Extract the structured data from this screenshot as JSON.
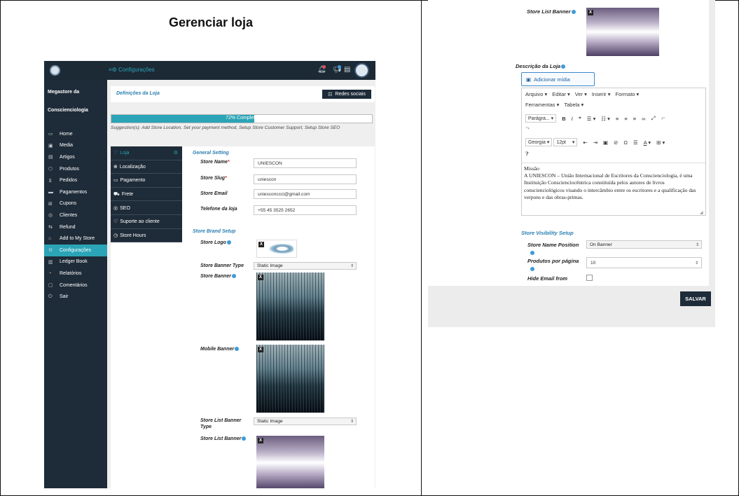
{
  "caption": "Gerenciar loja",
  "left": {
    "topbar": {
      "config_label": "Configurações"
    },
    "sidebar": {
      "store_name_1": "Megastore da",
      "store_name_2": "Conscienciologia",
      "items": [
        {
          "label": "Home",
          "icon": "monitor-icon",
          "glyph": "▭"
        },
        {
          "label": "Media",
          "icon": "image-icon",
          "glyph": "▣"
        },
        {
          "label": "Artigos",
          "icon": "document-icon",
          "glyph": "▤"
        },
        {
          "label": "Produtos",
          "icon": "cube-icon",
          "glyph": "⬡"
        },
        {
          "label": "Pedidos",
          "icon": "cart-icon",
          "glyph": "⊻"
        },
        {
          "label": "Pagamentos",
          "icon": "card-icon",
          "glyph": "▬"
        },
        {
          "label": "Cupons",
          "icon": "gift-icon",
          "glyph": "⊞"
        },
        {
          "label": "Clientes",
          "icon": "user-icon",
          "glyph": "◎"
        },
        {
          "label": "Refund",
          "icon": "refund-icon",
          "glyph": "⇆"
        },
        {
          "label": "Add to My Store",
          "icon": "store-add-icon",
          "glyph": "⌂"
        },
        {
          "label": "Configurações",
          "icon": "settings-icon",
          "glyph": "⚙",
          "active": true
        },
        {
          "label": "Ledger Book",
          "icon": "book-icon",
          "glyph": "▥"
        },
        {
          "label": "Relatórios",
          "icon": "chart-icon",
          "glyph": "◔"
        },
        {
          "label": "Comentários",
          "icon": "comment-icon",
          "glyph": "▢"
        },
        {
          "label": "Sair",
          "icon": "power-icon",
          "glyph": "⏻"
        }
      ]
    },
    "header": {
      "title": "Definições da Loja",
      "social_button": "Redes sociais"
    },
    "progress": {
      "percent": 72,
      "label": "72% Complete!"
    },
    "suggestion": "Suggestion(s): Add Store Location, Set your payment method, Setup Store Customer Support, Setup Store SEO",
    "subnav": [
      {
        "label": "Loja",
        "icon": "thumbs-up-icon",
        "glyph": "♡",
        "active": true
      },
      {
        "label": "Localização",
        "icon": "globe-icon",
        "glyph": "⊕"
      },
      {
        "label": "Pagamento",
        "icon": "money-icon",
        "glyph": "▭"
      },
      {
        "label": "Frete",
        "icon": "truck-icon",
        "glyph": "⛟"
      },
      {
        "label": "SEO",
        "icon": "seo-icon",
        "glyph": "◎"
      },
      {
        "label": "Suporte ao cliente",
        "icon": "thumbs-up-icon",
        "glyph": "♡"
      },
      {
        "label": "Store Hours",
        "icon": "clock-icon",
        "glyph": "◷"
      }
    ],
    "general": {
      "title": "General Setting",
      "store_name_label": "Store Name",
      "store_name_value": "UNIESCON",
      "store_slug_label": "Store Slug",
      "store_slug_value": "uniescon",
      "store_email_label": "Store Email",
      "store_email_value": "uniesconccci@gmail.com",
      "phone_label": "Telefone da loja",
      "phone_value": "+55 45 3525 2652"
    },
    "brand": {
      "title": "Store Brand Setup",
      "logo_label": "Store Logo",
      "banner_type_label": "Store Banner Type",
      "banner_type_value": "Static Image",
      "banner_label": "Store Banner",
      "mobile_banner_label": "Mobile Banner",
      "list_banner_type_label": "Store List Banner Type",
      "list_banner_type_value": "Static Image",
      "list_banner_label": "Store List Banner"
    }
  },
  "right": {
    "list_banner_label": "Store List Banner",
    "description_label": "Descrição da Loja",
    "add_media": "Adicionar mídia",
    "menu": [
      "Arquivo ▾",
      "Editar ▾",
      "Ver ▾",
      "Inserir ▾",
      "Formato ▾"
    ],
    "menu2": [
      "Ferramentas ▾",
      "Tabela ▾"
    ],
    "format_select": "Parágra... ▾",
    "font_select": "Georgia ▾",
    "size_select": "12pt",
    "body": {
      "line1": "Missão",
      "line2": "A UNIESCON – União Internacional de Escritores da Conscienciologia, é uma Instituição Conscienciocêntrica constituída pelos autores de livros conscienciológicos visando o intercâmbio entre os escritores e a qualificação das verpons e das obras-primas."
    },
    "visibility": {
      "title": "Store Visibility Setup",
      "name_position_label": "Store Name Position",
      "name_position_value": "On Banner",
      "per_page_label": "Produtos por página",
      "per_page_value": "10",
      "hide_email_label": "Hide Email from"
    },
    "save": "SALVAR"
  },
  "colors": {
    "sidebar": "#1e2b38",
    "accent": "#2aa4b6",
    "link": "#2a7fb0"
  }
}
